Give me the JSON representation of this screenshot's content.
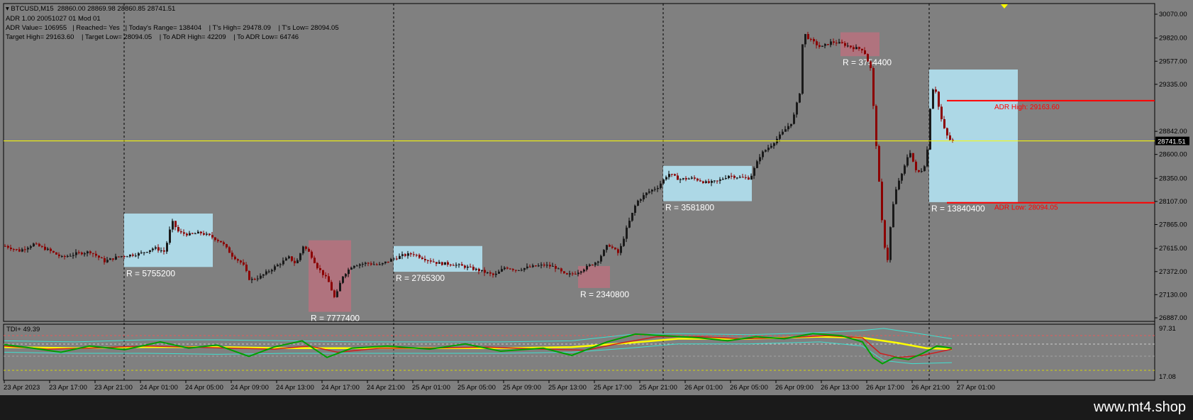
{
  "header": {
    "symbol_line": "BTCUSD,M15  28860.00 28869.98 28860.85 28741.51",
    "indicator_line": "ADR 1.00 20051027 01 Mod 01",
    "adr_line": "ADR Value= 106955   | Reached= Yes   | Today's Range= 138404    | T's High= 29478.09    | T's Low= 28094.05",
    "target_line": "Target High= 29163.60    | Target Low= 28094.05    | To ADR High= 42209    | To ADR Low= 64746"
  },
  "tdi": {
    "label": "TDI+ 49.39",
    "levels": [
      "97.31",
      "17.08"
    ]
  },
  "footer": {
    "brand": "www.mt4.shop"
  },
  "colors": {
    "background": "#808080",
    "bull_candle": "#000000",
    "bear_candle": "#8b0000",
    "box_blue": "#add8e6",
    "box_pink": "#b0737e",
    "current_price_line": "#ffff00",
    "adr_line": "#ff0000",
    "tdi_green": "#00a000",
    "tdi_red": "#cc2020",
    "tdi_yellow": "#ffff00",
    "tdi_cyan": "#40e0d0"
  },
  "chart_data": {
    "type": "candlestick",
    "symbol": "BTCUSD",
    "timeframe": "M15",
    "y_ticks": [
      "30070.00",
      "29820.00",
      "29577.00",
      "29335.00",
      "28842.00",
      "28600.00",
      "28350.00",
      "28107.00",
      "27865.00",
      "27615.00",
      "27372.00",
      "27130.00",
      "26887.00"
    ],
    "ylim": [
      26887,
      30070
    ],
    "x_ticks": [
      "23 Apr 2023",
      "23 Apr 17:00",
      "23 Apr 21:00",
      "24 Apr 01:00",
      "24 Apr 05:00",
      "24 Apr 09:00",
      "24 Apr 13:00",
      "24 Apr 17:00",
      "24 Apr 21:00",
      "25 Apr 01:00",
      "25 Apr 05:00",
      "25 Apr 09:00",
      "25 Apr 13:00",
      "25 Apr 17:00",
      "25 Apr 21:00",
      "26 Apr 01:00",
      "26 Apr 05:00",
      "26 Apr 09:00",
      "26 Apr 13:00",
      "26 Apr 17:00",
      "26 Apr 21:00",
      "27 Apr 01:00"
    ],
    "current_price": {
      "label": "28741.51",
      "value": 28741.51
    },
    "adr_high": {
      "label": "ADR High: 29163.60",
      "value": 29163.6
    },
    "adr_low": {
      "label": "ADR Low: 28094.05",
      "value": 28094.05
    },
    "range_boxes": [
      {
        "label": "R = 5755200",
        "kind": "blue",
        "high": 27980,
        "low": 27420
      },
      {
        "label": "R = 7777400",
        "kind": "pink",
        "high": 27700,
        "low": 26950
      },
      {
        "label": "R = 2765300",
        "kind": "blue",
        "high": 27640,
        "low": 27370
      },
      {
        "label": "R = 2340800",
        "kind": "pink",
        "high": 27430,
        "low": 27200
      },
      {
        "label": "R = 3581800",
        "kind": "blue",
        "high": 28480,
        "low": 28110
      },
      {
        "label": "R = 3754400",
        "kind": "pink",
        "high": 29880,
        "low": 29630
      },
      {
        "label": "R = 13840400",
        "kind": "blue",
        "high": 29490,
        "low": 28100
      }
    ],
    "price_path": [
      [
        0,
        27640
      ],
      [
        20,
        27590
      ],
      [
        40,
        27660
      ],
      [
        60,
        27600
      ],
      [
        80,
        27520
      ],
      [
        100,
        27560
      ],
      [
        120,
        27580
      ],
      [
        140,
        27480
      ],
      [
        160,
        27530
      ],
      [
        170,
        27540
      ],
      [
        190,
        27560
      ],
      [
        210,
        27620
      ],
      [
        225,
        27580
      ],
      [
        235,
        27900
      ],
      [
        245,
        27780
      ],
      [
        260,
        27760
      ],
      [
        275,
        27780
      ],
      [
        290,
        27740
      ],
      [
        305,
        27680
      ],
      [
        320,
        27540
      ],
      [
        335,
        27450
      ],
      [
        345,
        27280
      ],
      [
        360,
        27320
      ],
      [
        380,
        27420
      ],
      [
        400,
        27520
      ],
      [
        410,
        27450
      ],
      [
        420,
        27640
      ],
      [
        430,
        27560
      ],
      [
        440,
        27420
      ],
      [
        455,
        27280
      ],
      [
        465,
        27080
      ],
      [
        475,
        27320
      ],
      [
        490,
        27440
      ],
      [
        510,
        27460
      ],
      [
        528,
        27440
      ],
      [
        545,
        27500
      ],
      [
        560,
        27540
      ],
      [
        575,
        27560
      ],
      [
        590,
        27510
      ],
      [
        610,
        27460
      ],
      [
        630,
        27450
      ],
      [
        650,
        27420
      ],
      [
        670,
        27380
      ],
      [
        690,
        27330
      ],
      [
        705,
        27420
      ],
      [
        720,
        27390
      ],
      [
        740,
        27420
      ],
      [
        760,
        27440
      ],
      [
        775,
        27420
      ],
      [
        790,
        27330
      ],
      [
        805,
        27360
      ],
      [
        820,
        27420
      ],
      [
        835,
        27480
      ],
      [
        850,
        27660
      ],
      [
        865,
        27560
      ],
      [
        875,
        27800
      ],
      [
        890,
        28100
      ],
      [
        905,
        28200
      ],
      [
        920,
        28260
      ],
      [
        935,
        28400
      ],
      [
        950,
        28340
      ],
      [
        970,
        28350
      ],
      [
        990,
        28300
      ],
      [
        1005,
        28320
      ],
      [
        1020,
        28380
      ],
      [
        1035,
        28360
      ],
      [
        1050,
        28350
      ],
      [
        1065,
        28600
      ],
      [
        1080,
        28700
      ],
      [
        1095,
        28820
      ],
      [
        1110,
        28950
      ],
      [
        1120,
        29250
      ],
      [
        1125,
        29880
      ],
      [
        1135,
        29800
      ],
      [
        1150,
        29720
      ],
      [
        1165,
        29780
      ],
      [
        1180,
        29760
      ],
      [
        1195,
        29720
      ],
      [
        1210,
        29700
      ],
      [
        1220,
        29500
      ],
      [
        1228,
        28700
      ],
      [
        1232,
        28300
      ],
      [
        1238,
        27700
      ],
      [
        1244,
        27500
      ],
      [
        1250,
        28000
      ],
      [
        1258,
        28300
      ],
      [
        1265,
        28400
      ],
      [
        1275,
        28650
      ],
      [
        1285,
        28400
      ],
      [
        1295,
        28450
      ],
      [
        1300,
        28650
      ],
      [
        1305,
        29200
      ],
      [
        1310,
        29350
      ],
      [
        1316,
        29100
      ],
      [
        1322,
        28900
      ],
      [
        1330,
        28760
      ],
      [
        1336,
        28741
      ]
    ],
    "tdi_lines": {
      "green": [
        [
          0,
          65
        ],
        [
          40,
          58
        ],
        [
          80,
          50
        ],
        [
          120,
          62
        ],
        [
          170,
          55
        ],
        [
          220,
          70
        ],
        [
          260,
          58
        ],
        [
          300,
          64
        ],
        [
          345,
          42
        ],
        [
          380,
          60
        ],
        [
          420,
          72
        ],
        [
          455,
          40
        ],
        [
          490,
          58
        ],
        [
          540,
          62
        ],
        [
          600,
          56
        ],
        [
          650,
          66
        ],
        [
          700,
          52
        ],
        [
          760,
          58
        ],
        [
          800,
          44
        ],
        [
          850,
          70
        ],
        [
          890,
          85
        ],
        [
          930,
          82
        ],
        [
          980,
          78
        ],
        [
          1020,
          72
        ],
        [
          1060,
          80
        ],
        [
          1100,
          76
        ],
        [
          1140,
          86
        ],
        [
          1180,
          82
        ],
        [
          1210,
          70
        ],
        [
          1225,
          40
        ],
        [
          1238,
          28
        ],
        [
          1255,
          40
        ],
        [
          1275,
          36
        ],
        [
          1295,
          48
        ],
        [
          1315,
          62
        ],
        [
          1336,
          58
        ]
      ],
      "red": [
        [
          0,
          62
        ],
        [
          60,
          56
        ],
        [
          120,
          58
        ],
        [
          200,
          62
        ],
        [
          260,
          60
        ],
        [
          320,
          58
        ],
        [
          380,
          56
        ],
        [
          430,
          62
        ],
        [
          470,
          50
        ],
        [
          530,
          58
        ],
        [
          600,
          58
        ],
        [
          680,
          60
        ],
        [
          760,
          56
        ],
        [
          820,
          54
        ],
        [
          870,
          68
        ],
        [
          920,
          80
        ],
        [
          980,
          80
        ],
        [
          1040,
          76
        ],
        [
          1100,
          78
        ],
        [
          1160,
          82
        ],
        [
          1210,
          78
        ],
        [
          1235,
          48
        ],
        [
          1260,
          40
        ],
        [
          1295,
          44
        ],
        [
          1336,
          56
        ]
      ],
      "yellow": [
        [
          0,
          60
        ],
        [
          100,
          58
        ],
        [
          200,
          60
        ],
        [
          300,
          60
        ],
        [
          400,
          58
        ],
        [
          500,
          58
        ],
        [
          600,
          58
        ],
        [
          700,
          58
        ],
        [
          800,
          60
        ],
        [
          880,
          68
        ],
        [
          950,
          76
        ],
        [
          1050,
          76
        ],
        [
          1150,
          80
        ],
        [
          1210,
          78
        ],
        [
          1260,
          68
        ],
        [
          1300,
          58
        ],
        [
          1336,
          56
        ]
      ],
      "cyan_upper": [
        [
          0,
          72
        ],
        [
          100,
          70
        ],
        [
          200,
          74
        ],
        [
          300,
          74
        ],
        [
          400,
          72
        ],
        [
          500,
          70
        ],
        [
          600,
          70
        ],
        [
          700,
          70
        ],
        [
          800,
          72
        ],
        [
          880,
          84
        ],
        [
          950,
          86
        ],
        [
          1050,
          84
        ],
        [
          1150,
          88
        ],
        [
          1210,
          92
        ],
        [
          1240,
          96
        ],
        [
          1280,
          88
        ],
        [
          1336,
          76
        ]
      ],
      "cyan_lower": [
        [
          0,
          50
        ],
        [
          100,
          48
        ],
        [
          200,
          48
        ],
        [
          300,
          46
        ],
        [
          400,
          48
        ],
        [
          500,
          48
        ],
        [
          600,
          48
        ],
        [
          700,
          48
        ],
        [
          800,
          50
        ],
        [
          880,
          58
        ],
        [
          950,
          66
        ],
        [
          1050,
          66
        ],
        [
          1150,
          70
        ],
        [
          1210,
          62
        ],
        [
          1240,
          34
        ],
        [
          1280,
          28
        ],
        [
          1336,
          30
        ]
      ]
    }
  }
}
